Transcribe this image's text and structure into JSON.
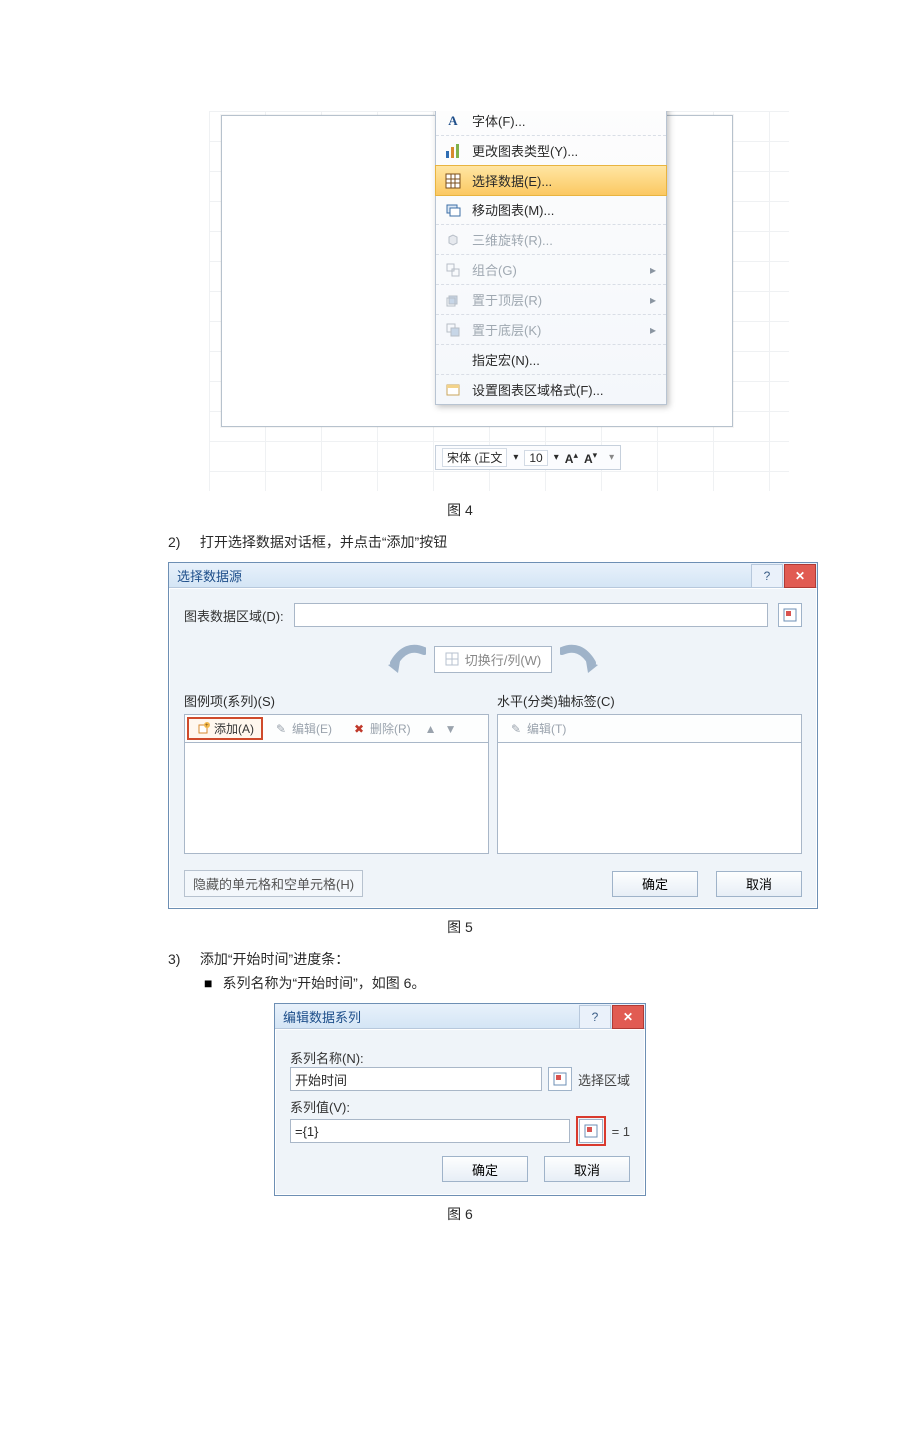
{
  "captions": {
    "fig4": "图 4",
    "fig5": "图 5",
    "fig6": "图 6"
  },
  "steps": {
    "s2_num": "2)",
    "s2_text": "打开选择数据对话框，并点击“添加”按钮",
    "s3_num": "3)",
    "s3_text": "添加“开始时间”进度条：",
    "s3_b1": "系列名称为“开始时间”，如图 6。"
  },
  "contextMenu": {
    "items": [
      {
        "label": "字体(F)...",
        "underline": "F",
        "icon": "font",
        "enabled": true,
        "submenu": false
      },
      {
        "label": "更改图表类型(Y)...",
        "underline": "Y",
        "icon": "bars",
        "enabled": true,
        "submenu": false
      },
      {
        "label": "选择数据(E)...",
        "underline": "E",
        "icon": "grid",
        "enabled": true,
        "submenu": false,
        "selected": true
      },
      {
        "label": "移动图表(M)...",
        "underline": "M",
        "icon": "move",
        "enabled": true,
        "submenu": false
      },
      {
        "label": "三维旋转(R)...",
        "underline": "R",
        "icon": "3d",
        "enabled": false,
        "submenu": false
      },
      {
        "label": "组合(G)",
        "underline": "G",
        "icon": "group",
        "enabled": false,
        "submenu": true
      },
      {
        "label": "置于顶层(R)",
        "underline": "R",
        "icon": "top",
        "enabled": false,
        "submenu": true
      },
      {
        "label": "置于底层(K)",
        "underline": "K",
        "icon": "bot",
        "enabled": false,
        "submenu": true
      },
      {
        "label": "指定宏(N)...",
        "underline": "N",
        "icon": "",
        "enabled": true,
        "submenu": false
      },
      {
        "label": "设置图表区域格式(F)...",
        "underline": "F",
        "icon": "fmt",
        "enabled": true,
        "submenu": false
      }
    ]
  },
  "miniToolbar": {
    "fontName": "宋体 (正文",
    "fontSize": "10",
    "grow": "A",
    "shrink": "A"
  },
  "dlg5": {
    "title": "选择数据源",
    "chartRange": "图表数据区域(D):",
    "switch": "切换行/列(W)",
    "legendHead": "图例项(系列)(S)",
    "axisHead": "水平(分类)轴标签(C)",
    "add": "添加(A)",
    "edit": "编辑(E)",
    "remove": "删除(R)",
    "edit2": "编辑(T)",
    "hidden": "隐藏的单元格和空单元格(H)",
    "ok": "确定",
    "cancel": "取消"
  },
  "dlg6": {
    "title": "编辑数据系列",
    "nameLabel": "系列名称(N):",
    "nameValue": "开始时间",
    "nameHint": "选择区域",
    "valLabel": "系列值(V):",
    "valValue": "={1}",
    "valHint": "= 1",
    "ok": "确定",
    "cancel": "取消"
  }
}
